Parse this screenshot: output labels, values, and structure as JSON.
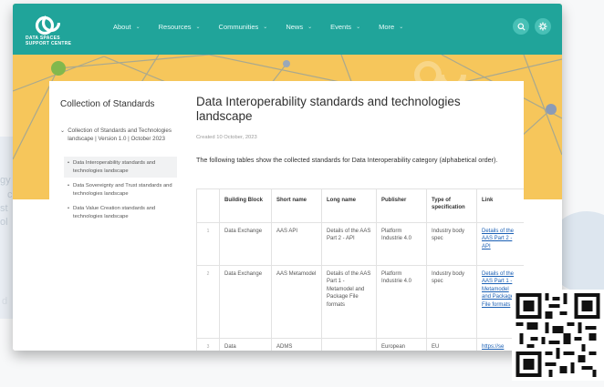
{
  "background": {
    "left_fragments": [
      "gy",
      "c",
      "st",
      "ol",
      "d"
    ]
  },
  "nav": {
    "logo_text": [
      "DATA SPACES",
      "SUPPORT CENTRE"
    ],
    "items": [
      {
        "label": "About",
        "chevron": "⌄"
      },
      {
        "label": "Resources",
        "chevron": "⌄"
      },
      {
        "label": "Communities",
        "chevron": "⌄"
      },
      {
        "label": "News",
        "chevron": "⌄"
      },
      {
        "label": "Events",
        "chevron": "⌄"
      },
      {
        "label": "More",
        "chevron": "⌄"
      }
    ],
    "search_icon": "search-icon",
    "settings_icon": "gear-icon"
  },
  "sidebar": {
    "title": "Collection of Standards",
    "parent": "Collection of Standards and Technologies landscape | Version 1.0 | October 2023",
    "items": [
      {
        "label": "Data Interoperability standards and technologies landscape",
        "active": true
      },
      {
        "label": "Data Sovereignty and Trust standards and technologies landscape",
        "active": false
      },
      {
        "label": "Data Value Creation standards and technologies landscape",
        "active": false
      }
    ]
  },
  "main": {
    "title": "Data Interoperability standards and technologies landscape",
    "created": "Created 10 October, 2023",
    "intro": "The following tables show the collected standards for Data Interoperability category (alphabetical order).",
    "table": {
      "headers": [
        "",
        "Building Block",
        "Short name",
        "Long name",
        "Publisher",
        "Type of specification",
        "Link"
      ],
      "rows": [
        {
          "num": "1",
          "block": "Data Exchange",
          "short": "AAS API",
          "long": "Details of the AAS Part 2 - API",
          "publisher": "Platform Industrie 4.0",
          "type": "Industry body spec",
          "link": "Details of the AAS Part 2 - API"
        },
        {
          "num": "2",
          "block": "Data Exchange",
          "short": "AAS Metamodel",
          "long": "Details of the AAS Part 1 - Metamodel and Package File formats",
          "publisher": "Platform Industrie 4.0",
          "type": "Industry body spec",
          "link": "Details of the AAS Part 1 - Metamodel and Package File formats"
        },
        {
          "num": "3",
          "block": "Data",
          "short": "ADMS",
          "long": "",
          "publisher": "European",
          "type": "EU",
          "link": "https://se"
        }
      ]
    }
  },
  "colors": {
    "nav": "#20a49a",
    "hero": "#f6c65b",
    "link": "#1a5fb4",
    "active_bg": "#f1f2f3"
  }
}
